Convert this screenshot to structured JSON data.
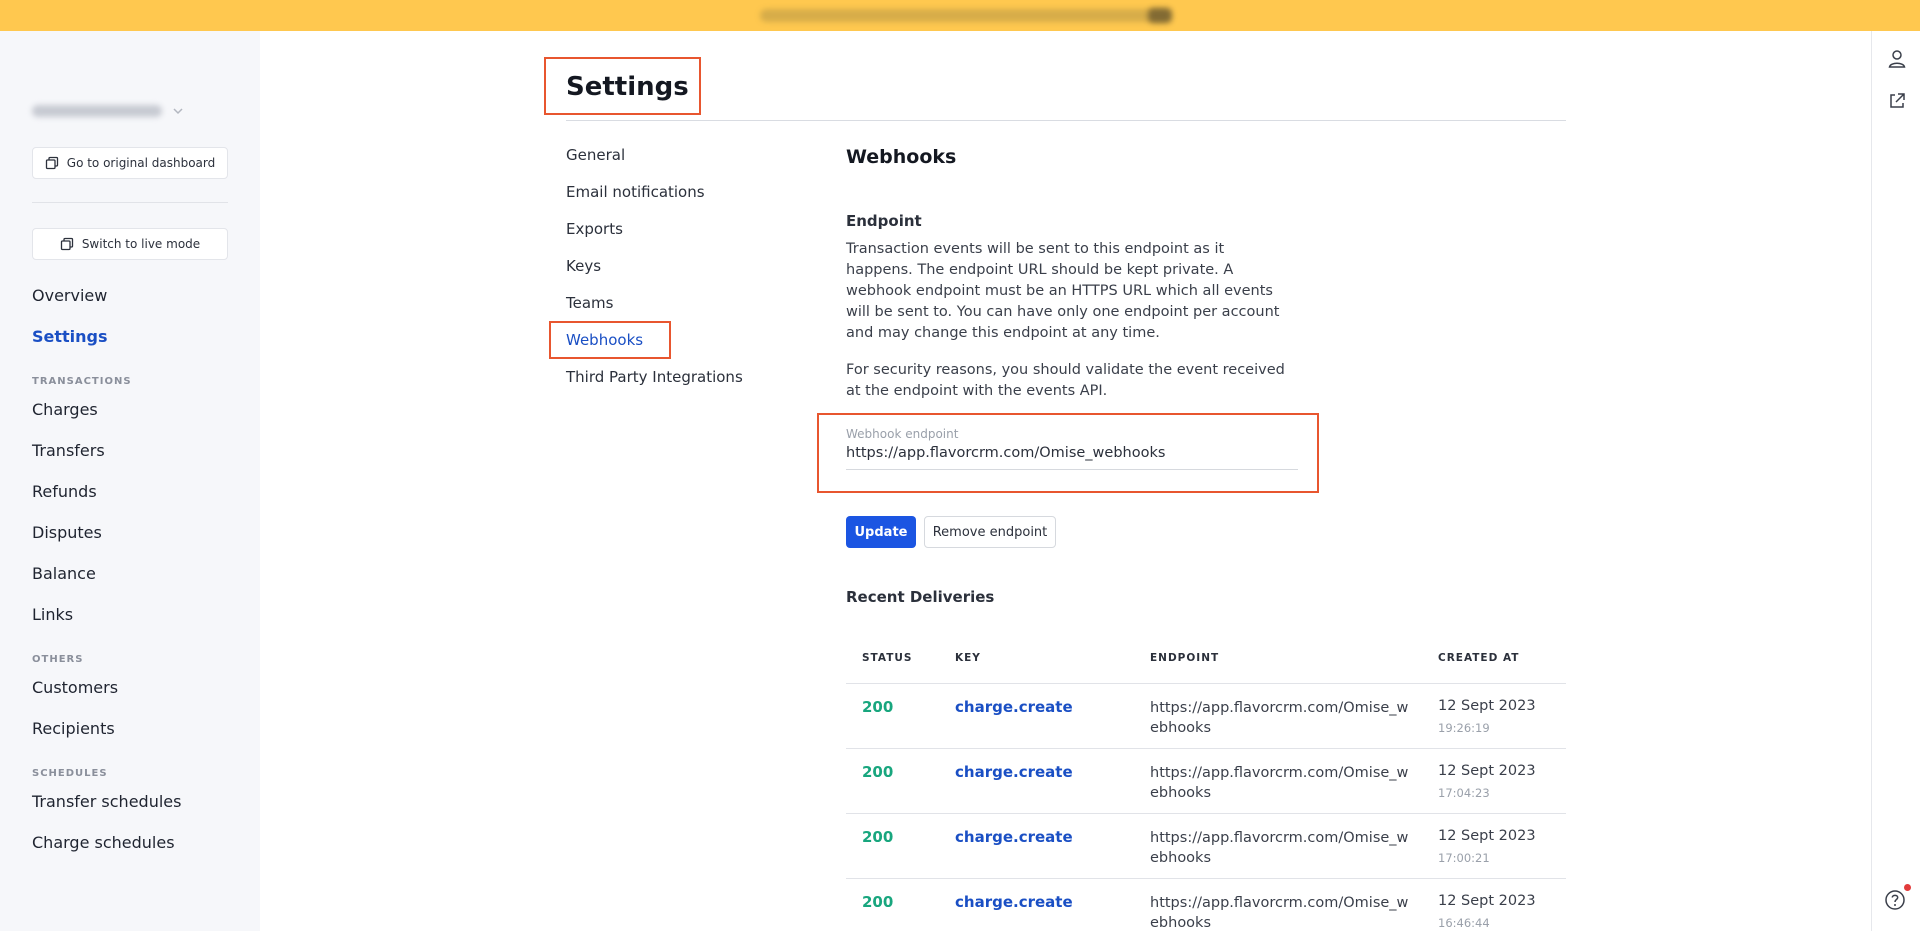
{
  "sidebar": {
    "go_original_label": "Go to original dashboard",
    "switch_live_label": "Switch to live mode",
    "nav": [
      {
        "label": "Overview"
      },
      {
        "label": "Settings"
      }
    ],
    "sections": [
      {
        "title": "TRANSACTIONS",
        "items": [
          "Charges",
          "Transfers",
          "Refunds",
          "Disputes",
          "Balance",
          "Links"
        ]
      },
      {
        "title": "OTHERS",
        "items": [
          "Customers",
          "Recipients"
        ]
      },
      {
        "title": "SCHEDULES",
        "items": [
          "Transfer schedules",
          "Charge schedules"
        ]
      }
    ]
  },
  "page": {
    "title": "Settings",
    "subnav": [
      "General",
      "Email notifications",
      "Exports",
      "Keys",
      "Teams",
      "Webhooks",
      "Third Party Integrations"
    ],
    "active_subnav": "Webhooks"
  },
  "webhooks": {
    "title": "Webhooks",
    "endpoint_heading": "Endpoint",
    "description_1": "Transaction events will be sent to this endpoint as it happens. The endpoint URL should be kept private. A webhook endpoint must be an HTTPS URL which all events will be sent to. You can have only one endpoint per account and may change this endpoint at any time.",
    "description_2": "For security reasons, you should validate the event received at the endpoint with the events API.",
    "field_label": "Webhook endpoint",
    "field_value": "https://app.flavorcrm.com/Omise_webhooks",
    "update_label": "Update",
    "remove_label": "Remove endpoint",
    "recent_title": "Recent Deliveries",
    "table": {
      "headers": [
        "STATUS",
        "KEY",
        "ENDPOINT",
        "CREATED AT"
      ],
      "rows": [
        {
          "status": "200",
          "key": "charge.create",
          "endpoint": "https://app.flavorcrm.com/Omise_webhooks",
          "date": "12 Sept 2023",
          "time": "19:26:19"
        },
        {
          "status": "200",
          "key": "charge.create",
          "endpoint": "https://app.flavorcrm.com/Omise_webhooks",
          "date": "12 Sept 2023",
          "time": "17:04:23"
        },
        {
          "status": "200",
          "key": "charge.create",
          "endpoint": "https://app.flavorcrm.com/Omise_webhooks",
          "date": "12 Sept 2023",
          "time": "17:00:21"
        },
        {
          "status": "200",
          "key": "charge.create",
          "endpoint": "https://app.flavorcrm.com/Omise_webhooks",
          "date": "12 Sept 2023",
          "time": "16:46:44"
        }
      ]
    }
  },
  "colors": {
    "banner": "#ffc84f",
    "accent_blue": "#1a4fc4",
    "primary_button": "#1b55e2",
    "status_success": "#18a67e",
    "highlight_box": "#e8562f"
  },
  "icons": {
    "copy": "copy-icon",
    "user": "user-icon",
    "external": "external-link-icon",
    "help": "help-icon",
    "caret": "chevron-down-icon"
  }
}
